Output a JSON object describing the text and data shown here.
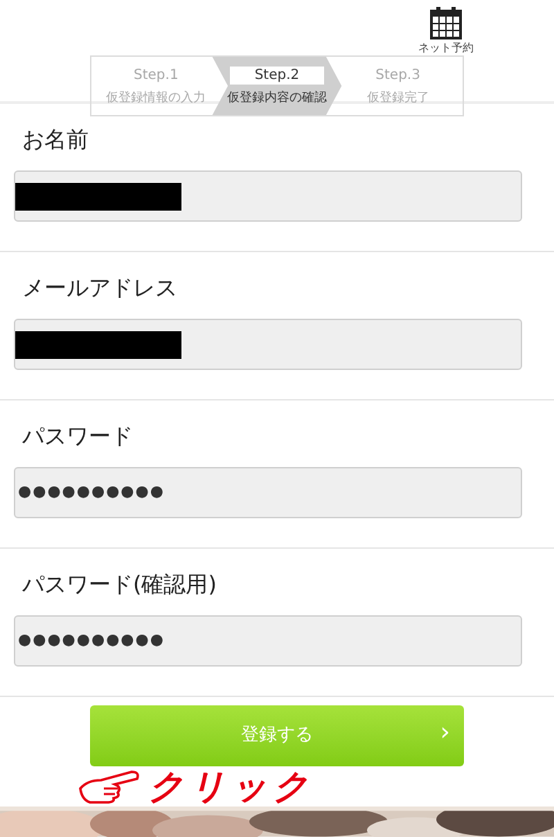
{
  "header": {
    "reservation_link": "ネット予約"
  },
  "steps": [
    {
      "step": "Step.1",
      "label": "仮登録情報の入力",
      "selected": false
    },
    {
      "step": "Step.2",
      "label": "仮登録内容の確認",
      "selected": true
    },
    {
      "step": "Step.3",
      "label": "仮登録完了",
      "selected": false
    }
  ],
  "fields": [
    {
      "label": "お名前",
      "kind": "redacted"
    },
    {
      "label": "メールアドレス",
      "kind": "redacted"
    },
    {
      "label": "パスワード",
      "kind": "password",
      "value": "●●●●●●●●●●"
    },
    {
      "label": "パスワード(確認用)",
      "kind": "password",
      "value": "●●●●●●●●●●"
    }
  ],
  "submit_button": {
    "label": "登録する",
    "arrow": "›"
  },
  "annotation": {
    "text": "クリック"
  }
}
